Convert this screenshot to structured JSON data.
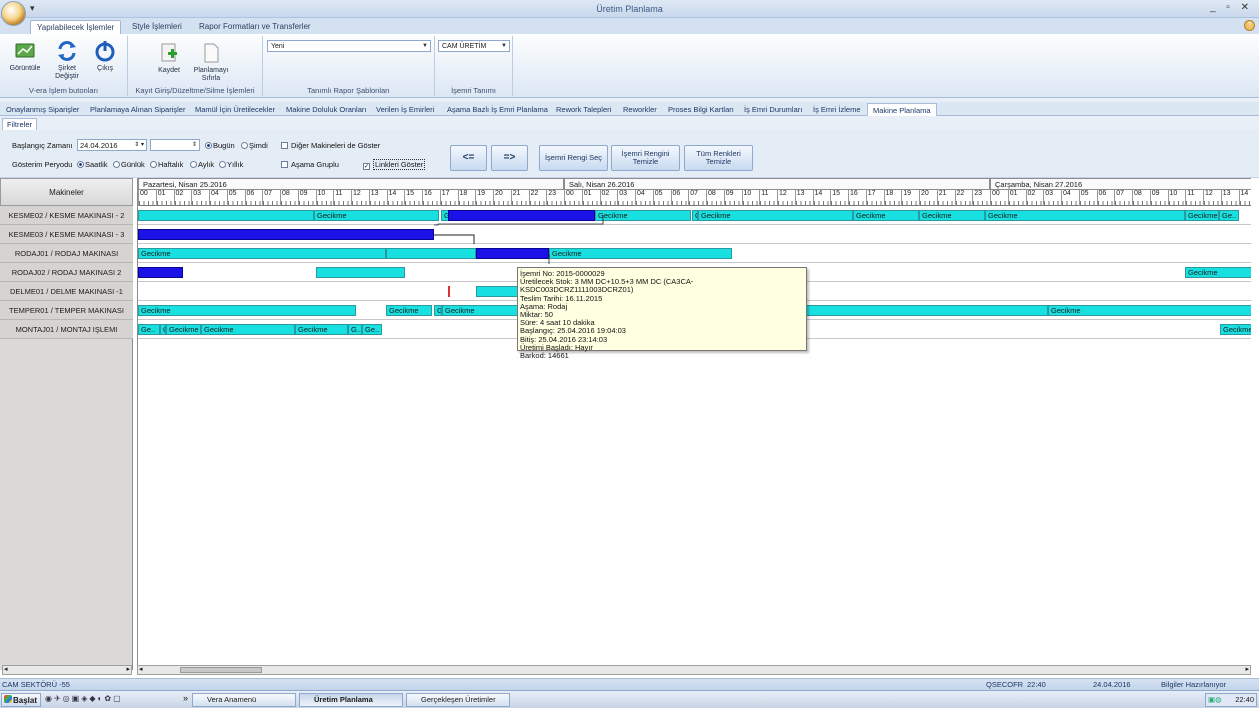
{
  "window": {
    "title": "Üretim Planlama",
    "qat": "▾",
    "controls": "_ ▫ ✕"
  },
  "ribbon_tabs": [
    "Yapılabilecek İşlemler",
    "Style İşlemleri",
    "Rapor Formatları ve Transferler"
  ],
  "ribbon": {
    "group1": {
      "label": "V-era İşlem butonları",
      "buttons": [
        "Görüntüle",
        "Şirket Değiştir",
        "Çıkış"
      ]
    },
    "group2": {
      "label": "Kayıt Giriş/Düzeltme/Silme İşlemleri",
      "buttons": [
        "Kaydet",
        "Planlamayı Sıfırla"
      ]
    },
    "group3": {
      "label": "Tanımlı Rapor Şablonları",
      "combo": "Yeni"
    },
    "group4": {
      "label": "İşemri Tanımı",
      "combo": "CAM ÜRETİM"
    }
  },
  "nav_tabs": [
    "Onaylanmış Siparişler",
    "Planlamaya Alınan Siparişler",
    "Mamül İçin Üretilecekler",
    "Makine Doluluk Oranları",
    "Verilen İş Emirleri",
    "Aşama Bazlı İş Emri Planlama",
    "Rework Talepleri",
    "Reworkler",
    "Proses Bilgi Kartları",
    "İş Emri Durumları",
    "İş Emri İzleme",
    "Makine Planlama"
  ],
  "filters": {
    "tab": "Filtreler",
    "start_label": "Başlangıç Zamanı",
    "start_date": "24.04.2016",
    "start_time": "",
    "today": "Bugün",
    "now": "Şimdi",
    "show_other": "Diğer Makineleri de Göster",
    "period_label": "Gösterim Peryodu",
    "periods": [
      "Saatlik",
      "Günlük",
      "Haftalık",
      "Aylık",
      "Yıllık"
    ],
    "stage_group": "Aşama Gruplu",
    "show_links": "Linkleri Göster",
    "prev": "<=",
    "next": "=>",
    "pick_color": "İşemri Rengi Seç",
    "clear_color": "İşemri Rengini Temizle",
    "clear_all": "Tüm Renkleri Temizle"
  },
  "gantt": {
    "machines_header": "Makineler",
    "machines": [
      "KESME02 / KESME MAKINASI - 2",
      "KESME03 / KESME MAKINASI - 3",
      "RODAJ01 / RODAJ MAKINASI",
      "RODAJ02 / RODAJ MAKINASI 2",
      "DELME01 / DELME MAKINASI -1",
      "TEMPER01 / TEMPER MAKINASI",
      "MONTAJ01 / MONTAJ IŞLEMI"
    ],
    "days": [
      "Pazartesi, Nisan 25.2016",
      "Salı, Nisan 26.2016",
      "Çarşamba, Nisan 27.2016"
    ],
    "hours": [
      "00",
      "01",
      "02",
      "03",
      "04",
      "05",
      "06",
      "07",
      "08",
      "09",
      "10",
      "11",
      "12",
      "13",
      "14",
      "15",
      "16",
      "17",
      "18",
      "19",
      "20",
      "21",
      "22",
      "23"
    ],
    "delay": "Gecikme",
    "delay_g": "G",
    "delay_ge": "Ge..",
    "delay_gd": "G..",
    "delay_gec": "Gecikme"
  },
  "tooltip": [
    "İşemri No: 2015-0000029",
    "Üretilecek Stok: 3 MM DC+10.5+3 MM DC (CA3CA-KSDC003DCRZ1111003DCRZ01)",
    "Teslim Tarihi: 16.11.2015",
    "Aşama: Rodaj",
    "Miktar: 50",
    "Süre: 4 saat 10 dakika",
    "Başlangıç: 25.04.2016 19:04:03",
    "Bitiş: 25.04.2016 23:14:03",
    "Üretimi Başladı: Hayır",
    "Barkod: 14661"
  ],
  "status": {
    "left": "CAM SEKTÖRÜ -55",
    "user": "QSECOFR",
    "time": "22:40",
    "date": "24.04.2016",
    "state": "Bilgiler Hazırlanıyor"
  },
  "taskbar": {
    "start": "Başlat",
    "items": [
      "Vera Anamenü",
      "Üretim Planlama",
      "Gerçekleşen Üretimler"
    ],
    "clock": "22:40",
    "more": "»"
  }
}
